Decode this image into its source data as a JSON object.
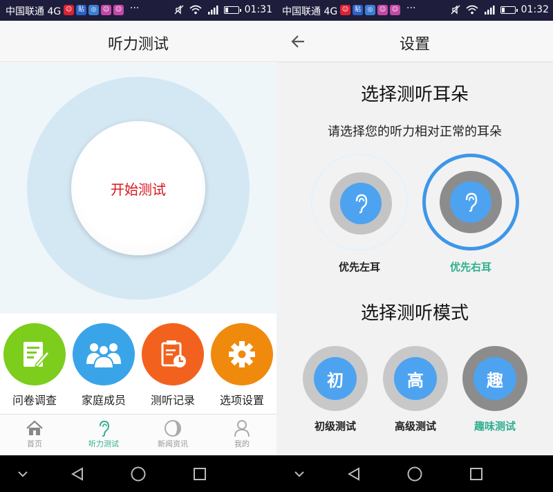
{
  "colors": {
    "status_bar": "#1f1d3c",
    "accent_red": "#d9141b",
    "accent_green": "#2fae8e",
    "accent_blue": "#4da3f0",
    "ring_blue": "#3d96ea"
  },
  "left_screen": {
    "status": {
      "carrier": "中国联通 4G",
      "more": "···",
      "time": "01:31"
    },
    "title": "听力测试",
    "start_button": "开始测试",
    "quick_actions": [
      {
        "label": "问卷调查",
        "icon": "questionnaire-icon",
        "color": "#7ccd1c"
      },
      {
        "label": "家庭成员",
        "icon": "family-members-icon",
        "color": "#3aa4e8"
      },
      {
        "label": "测听记录",
        "icon": "test-record-icon",
        "color": "#f2621e"
      },
      {
        "label": "选项设置",
        "icon": "settings-gear-icon",
        "color": "#f08a0c"
      }
    ],
    "tabs": [
      {
        "label": "首页",
        "icon": "home-icon",
        "active": false
      },
      {
        "label": "听力测试",
        "icon": "ear-icon",
        "active": true
      },
      {
        "label": "新闻资讯",
        "icon": "news-icon",
        "active": false
      },
      {
        "label": "我的",
        "icon": "profile-icon",
        "active": false
      }
    ]
  },
  "right_screen": {
    "status": {
      "carrier": "中国联通 4G",
      "more": "···",
      "time": "01:32"
    },
    "title": "设置",
    "ear_section": {
      "heading": "选择测听耳朵",
      "subtitle": "请选择您的听力相对正常的耳朵",
      "options": [
        {
          "label": "优先左耳",
          "selected": false
        },
        {
          "label": "优先右耳",
          "selected": true
        }
      ]
    },
    "mode_section": {
      "heading": "选择测听模式",
      "options": [
        {
          "glyph": "初",
          "label": "初级测试",
          "selected": false
        },
        {
          "glyph": "高",
          "label": "高级测试",
          "selected": false
        },
        {
          "glyph": "趣",
          "label": "趣味测试",
          "selected": true
        }
      ]
    }
  }
}
